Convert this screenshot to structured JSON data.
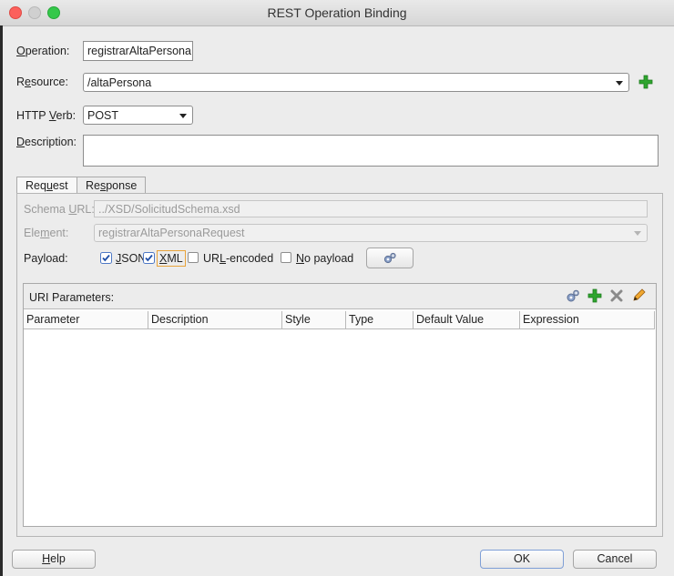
{
  "window": {
    "title": "REST Operation Binding"
  },
  "form": {
    "operation": {
      "label_pre": "",
      "label_mn": "O",
      "label_post": "peration:",
      "value": "registrarAltaPersona"
    },
    "resource": {
      "label_pre": "R",
      "label_mn": "e",
      "label_post": "source:",
      "value": "/altaPersona"
    },
    "http_verb": {
      "label_pre": "HTTP ",
      "label_mn": "V",
      "label_post": "erb:",
      "value": "POST"
    },
    "description": {
      "label_pre": "",
      "label_mn": "D",
      "label_post": "escription:",
      "value": ""
    }
  },
  "tabs": [
    {
      "pre": "Req",
      "mn": "u",
      "post": "est"
    },
    {
      "pre": "Re",
      "mn": "s",
      "post": "ponse"
    }
  ],
  "request": {
    "schema_url": {
      "label_pre": "Schema ",
      "label_mn": "U",
      "label_post": "RL:",
      "value": "../XSD/SolicitudSchema.xsd"
    },
    "element": {
      "label_pre": "Ele",
      "label_mn": "m",
      "label_post": "ent:",
      "value": "registrarAltaPersonaRequest"
    },
    "payload": {
      "label": "Payload:",
      "json": {
        "pre": "",
        "mn": "J",
        "post": "SON",
        "checked": true
      },
      "xml": {
        "pre": "",
        "mn": "X",
        "post": "ML",
        "checked": true
      },
      "urlenc": {
        "pre": "UR",
        "mn": "L",
        "post": "-encoded",
        "checked": false
      },
      "nopayload": {
        "pre": "",
        "mn": "N",
        "post": "o payload",
        "checked": false
      }
    }
  },
  "uri_params": {
    "title": "URI Parameters:",
    "columns": [
      "Parameter",
      "Description",
      "Style",
      "Type",
      "Default Value",
      "Expression"
    ],
    "rows": []
  },
  "buttons": {
    "help": {
      "pre": "",
      "mn": "H",
      "post": "elp"
    },
    "ok": "OK",
    "cancel": "Cancel"
  },
  "colors": {
    "add_green": "#2ea52e",
    "close_red": "#fc605c",
    "max_green": "#34c84a",
    "focus_orange": "#e8a33a"
  }
}
